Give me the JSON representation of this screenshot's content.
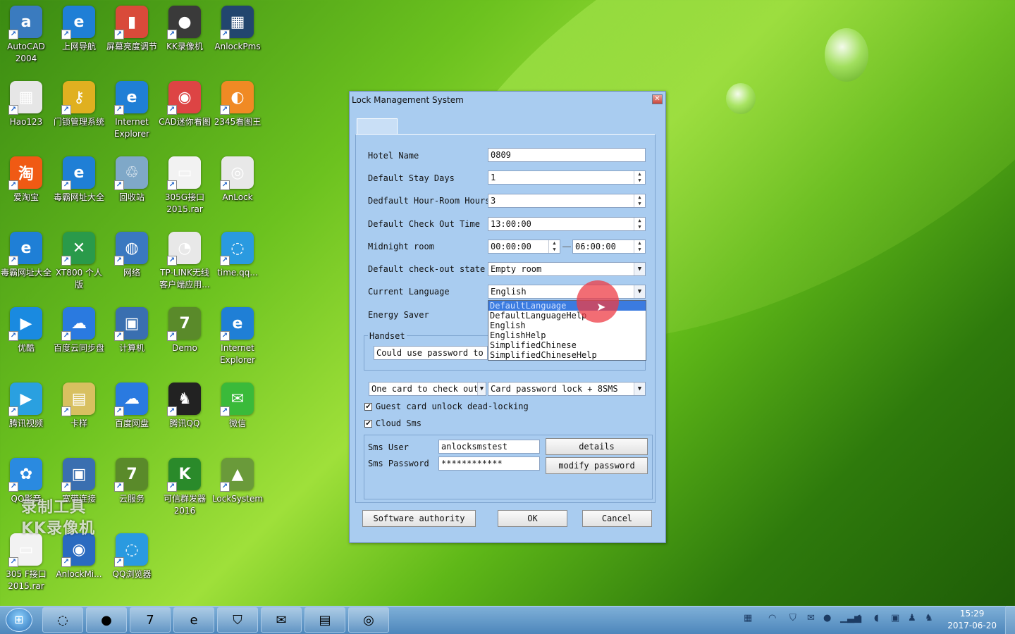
{
  "desktop": {
    "icons": [
      {
        "label": "AutoCAD 2004",
        "glyph": "a",
        "color": "#3a7bbf"
      },
      {
        "label": "上网导航",
        "glyph": "e",
        "color": "#1f7fd6"
      },
      {
        "label": "屏幕亮度调节",
        "glyph": "▮",
        "color": "#d94a3a"
      },
      {
        "label": "KK录像机",
        "glyph": "●",
        "color": "#3a3a3a"
      },
      {
        "label": "AnlockPms",
        "glyph": "▦",
        "color": "#22466e"
      },
      {
        "label": "Hao123",
        "glyph": "▦",
        "color": "#e6e6e6"
      },
      {
        "label": "门锁管理系统",
        "glyph": "⚷",
        "color": "#e0b020"
      },
      {
        "label": "Internet Explorer",
        "glyph": "e",
        "color": "#1f7fd6"
      },
      {
        "label": "CAD迷你看图",
        "glyph": "◉",
        "color": "#d44"
      },
      {
        "label": "2345看图王",
        "glyph": "◐",
        "color": "#f08a24"
      },
      {
        "label": "爱淘宝",
        "glyph": "淘",
        "color": "#f05a14"
      },
      {
        "label": "毒霸网址大全",
        "glyph": "e",
        "color": "#1f7fd6"
      },
      {
        "label": "回收站",
        "glyph": "♲",
        "color": "#7fa8c8"
      },
      {
        "label": "305G接口2015.rar",
        "glyph": "▭",
        "color": "#f2f2f2"
      },
      {
        "label": "AnLock",
        "glyph": "◎",
        "color": "#e8e8e8"
      },
      {
        "label": "毒霸网址大全",
        "glyph": "e",
        "color": "#1f7fd6"
      },
      {
        "label": "XT800 个人版",
        "glyph": "✕",
        "color": "#2a9a4a"
      },
      {
        "label": "网络",
        "glyph": "◍",
        "color": "#3a78c0"
      },
      {
        "label": "TP-LINK无线客户端应用...",
        "glyph": "◔",
        "color": "#e8e8e8"
      },
      {
        "label": "time.qq...",
        "glyph": "◌",
        "color": "#2a9ae0"
      },
      {
        "label": "优酷",
        "glyph": "▶",
        "color": "#1a8ae0"
      },
      {
        "label": "百度云同步盘",
        "glyph": "☁",
        "color": "#2a7ae0"
      },
      {
        "label": "计算机",
        "glyph": "▣",
        "color": "#3a6fb0"
      },
      {
        "label": "Demo",
        "glyph": "7",
        "color": "#5a8a2a"
      },
      {
        "label": "Internet Explorer",
        "glyph": "e",
        "color": "#1f7fd6"
      },
      {
        "label": "腾讯视频",
        "glyph": "▶",
        "color": "#2aa0e0"
      },
      {
        "label": "卡样",
        "glyph": "▤",
        "color": "#d8c060"
      },
      {
        "label": "百度网盘",
        "glyph": "☁",
        "color": "#2a7ae0"
      },
      {
        "label": "腾讯QQ",
        "glyph": "♞",
        "color": "#222"
      },
      {
        "label": "微信",
        "glyph": "✉",
        "color": "#3aba3a"
      },
      {
        "label": "QQ影音",
        "glyph": "✿",
        "color": "#2a8ae0"
      },
      {
        "label": "宽带连接",
        "glyph": "▣",
        "color": "#3a6fb0"
      },
      {
        "label": "云服务",
        "glyph": "7",
        "color": "#5a8a2a"
      },
      {
        "label": "可信群发器2016",
        "glyph": "K",
        "color": "#2a8a2a"
      },
      {
        "label": "LockSystem",
        "glyph": "▲",
        "color": "#6a9a3a"
      },
      {
        "label": "305 F接口2015.rar",
        "glyph": "▭",
        "color": "#f2f2f2"
      },
      {
        "label": "AnlockMi...",
        "glyph": "◉",
        "color": "#2a6ac0"
      },
      {
        "label": "QQ浏览器",
        "glyph": "◌",
        "color": "#2a9ae0"
      }
    ],
    "watermark_line1": "录制工具",
    "watermark_line2": "KK录像机"
  },
  "dialog": {
    "title": "Lock Management System",
    "close_glyph": "✕",
    "fields": {
      "hotel_name_label": "Hotel Name",
      "hotel_name_value": "0809",
      "stay_days_label": "Default Stay Days",
      "stay_days_value": "1",
      "hour_room_label": "Dedfault Hour-Room Hours",
      "hour_room_value": "3",
      "checkout_time_label": "Default Check Out Time",
      "checkout_time_value": "13:00:00",
      "midnight_label": "Midnight room",
      "midnight_from": "00:00:00",
      "midnight_to": "06:00:00",
      "checkout_state_label": "Default check-out state",
      "checkout_state_value": "Empty room",
      "language_label": "Current Language",
      "language_value": "English",
      "energy_label": "Energy Saver",
      "handset_label": "Handset",
      "handset_value": "Could use password to"
    },
    "language_options": [
      "DefaultLanguage",
      "DefaultLanguageHelp",
      "English",
      "EnglishHelp",
      "SimplifiedChinese",
      "SimplifiedChineseHelp"
    ],
    "card_mode_value": "One card to check out",
    "lock_mode_value": "Card password lock + 8SMS",
    "guest_unlock_label": "Guest card unlock dead-locking",
    "cloud_sms_label": "Cloud Sms",
    "check_glyph": "✔",
    "sms_user_label": "Sms User",
    "sms_user_value": "anlocksmstest",
    "sms_password_label": "Sms Password",
    "sms_password_value": "************",
    "details_button": "details",
    "modify_password_button": "modify password",
    "software_authority_button": "Software authority",
    "ok_button": "OK",
    "cancel_button": "Cancel"
  },
  "taskbar": {
    "start_glyph": "⊞",
    "clock_time": "15:29",
    "clock_date": "2017-06-20"
  }
}
